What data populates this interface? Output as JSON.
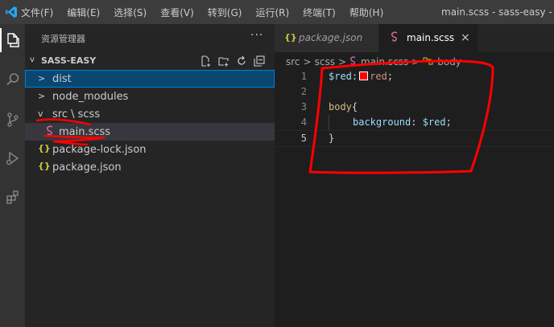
{
  "menu": {
    "items": [
      "文件(F)",
      "编辑(E)",
      "选择(S)",
      "查看(V)",
      "转到(G)",
      "运行(R)",
      "终端(T)",
      "帮助(H)"
    ],
    "window_title": "main.scss - sass-easy - V"
  },
  "activity_bar": {
    "icons": [
      "explorer-icon",
      "search-icon",
      "source-control-icon",
      "run-debug-icon",
      "extensions-icon"
    ]
  },
  "sidebar": {
    "title": "资源管理器",
    "more": "···",
    "folder_name": "SASS-EASY",
    "folder_chevron": "v",
    "tree": [
      {
        "label": "dist",
        "chevron": ">"
      },
      {
        "label": "node_modules",
        "chevron": ">"
      },
      {
        "label": "src \\ scss",
        "chevron": "v"
      },
      {
        "label": "main.scss",
        "icon": "sass-icon"
      },
      {
        "label": "package-lock.json",
        "icon": "{}"
      },
      {
        "label": "package.json",
        "icon": "{}"
      }
    ]
  },
  "tabs": [
    {
      "label": "package.json",
      "icon": "{}"
    },
    {
      "label": "main.scss",
      "icon": "sass-icon",
      "close": "×"
    }
  ],
  "breadcrumb": [
    "src",
    ">",
    "scss",
    ">",
    "main.scss",
    ">",
    "body"
  ],
  "editor": {
    "current_line": 5,
    "lines": [
      {
        "num": "1",
        "var": "$red",
        "colon": ":",
        "value": "red",
        "semi": ";"
      },
      {
        "num": "2"
      },
      {
        "num": "3",
        "selector": "body",
        "brace": "{"
      },
      {
        "num": "4",
        "prop": "background",
        "colon": ": ",
        "value": "$red",
        "semi": ";"
      },
      {
        "num": "5",
        "brace": "}"
      }
    ]
  },
  "colors": {
    "accent": "#007acc",
    "annotation": "#ff0000",
    "swatch": "#ff0000"
  }
}
